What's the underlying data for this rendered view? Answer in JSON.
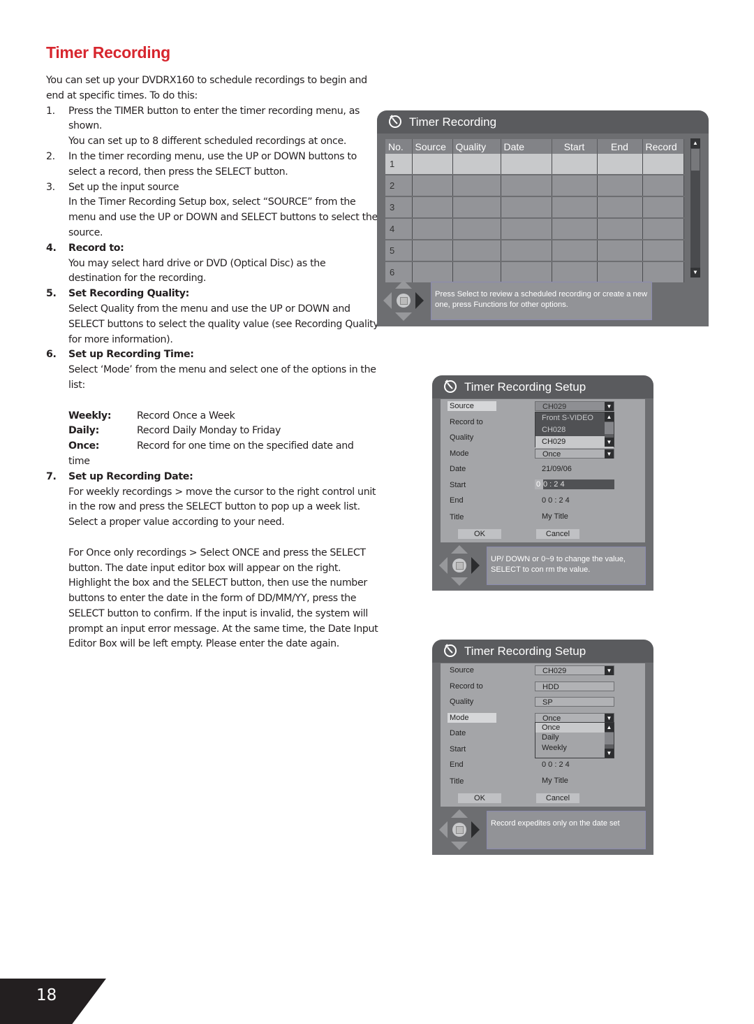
{
  "document": {
    "title": "Timer Recording",
    "intro": "You can set up your DVDRX160 to schedule recordings to begin and end at specific times. To do this:",
    "steps": [
      {
        "num": "1.",
        "heading": "",
        "text": "Press the TIMER button to enter the timer recording menu, as shown.",
        "extra": "You can set up to 8 different scheduled recordings at once."
      },
      {
        "num": "2.",
        "heading": "",
        "text": "In the timer recording menu, use the UP or DOWN buttons to select a record, then press the SELECT button.",
        "extra": ""
      },
      {
        "num": "3.",
        "heading": "",
        "text": "Set up the input source",
        "extra": "In the Timer Recording Setup box, select “SOURCE” from the menu and use the UP or DOWN and SELECT buttons to select the source."
      },
      {
        "num": "4.",
        "heading": "Record to:",
        "text": "You may select hard drive or DVD (Optical Disc) as the destination for the recording.",
        "extra": ""
      },
      {
        "num": "5.",
        "heading": "Set Recording Quality:",
        "text": "Select Quality from the menu and use the UP or DOWN and SELECT buttons to select the quality value (see Recording Quality for more information).",
        "extra": ""
      },
      {
        "num": "6.",
        "heading": "Set up Recording Time:",
        "text": "Select ‘Mode’ from the menu and select one of the options in the list:",
        "extra": ""
      },
      {
        "num": "7.",
        "heading": "Set up Recording Date:",
        "text": "For weekly recordings > move the cursor to the right control unit in the row and press the SELECT button to pop up a week list. Select a proper value according to your need.",
        "extra": "For Once only recordings > Select ONCE and press the SELECT button. The date input editor box will appear on the right. Highlight the box and the SELECT button, then use the number buttons to enter the date in the form of DD/MM/YY, press the SELECT button to confirm. If the input is invalid, the system will prompt an input error message. At the same time, the Date Input Editor Box will be left empty. Please enter the date again."
      }
    ],
    "modes": [
      {
        "key": "Weekly:",
        "desc": "Record Once a Week"
      },
      {
        "key": "Daily:",
        "desc": "Record Daily Monday to Friday"
      },
      {
        "key": "Once:",
        "desc": "Record for one time on the specified date and"
      }
    ],
    "modes_wrap": "time",
    "page_number": "18"
  },
  "timer_window": {
    "title": "Timer Recording",
    "icon": "timer-clock-icon",
    "columns": [
      "No.",
      "Source",
      "Quality",
      "Date",
      "Start",
      "End",
      "Record"
    ],
    "rows": [
      {
        "no": "1",
        "source": "",
        "quality": "",
        "date": "",
        "start": "",
        "end": "",
        "record": ""
      },
      {
        "no": "2",
        "source": "",
        "quality": "",
        "date": "",
        "start": "",
        "end": "",
        "record": ""
      },
      {
        "no": "3",
        "source": "",
        "quality": "",
        "date": "",
        "start": "",
        "end": "",
        "record": ""
      },
      {
        "no": "4",
        "source": "",
        "quality": "",
        "date": "",
        "start": "",
        "end": "",
        "record": ""
      },
      {
        "no": "5",
        "source": "",
        "quality": "",
        "date": "",
        "start": "",
        "end": "",
        "record": ""
      },
      {
        "no": "6",
        "source": "",
        "quality": "",
        "date": "",
        "start": "",
        "end": "",
        "record": ""
      }
    ],
    "selected_row": 0,
    "scroll_up": "▲",
    "scroll_down": "▼",
    "help": "Press Select to review a scheduled recording or create a new one, press Functions for other options."
  },
  "setup_window_1": {
    "title": "Timer Recording Setup",
    "labels": {
      "source": "Source",
      "record_to": "Record to",
      "quality": "Quality",
      "mode": "Mode",
      "date": "Date",
      "start": "Start",
      "end": "End",
      "title": "Title"
    },
    "values": {
      "source": "CH029",
      "mode": "Once",
      "date": "21/09/06",
      "start_cursor": "0",
      "start_rest": "0 : 2 4",
      "end": "0 0 : 2 4",
      "title": "My Title"
    },
    "source_dropdown": {
      "options": [
        "Front S-VIDEO",
        "CH028",
        "CH029"
      ],
      "selected": "CH029"
    },
    "ok": "OK",
    "cancel": "Cancel",
    "arrow_down": "▼",
    "arrow_up": "▲",
    "help": "UP/ DOWN or 0~9 to change the value, SELECT to con  rm the value."
  },
  "setup_window_2": {
    "title": "Timer Recording Setup",
    "labels": {
      "source": "Source",
      "record_to": "Record to",
      "quality": "Quality",
      "mode": "Mode",
      "date": "Date",
      "start": "Start",
      "end": "End",
      "title": "Title"
    },
    "values": {
      "source": "CH029",
      "record_to": "HDD",
      "quality": "SP",
      "mode": "Once",
      "end": "0 0 : 2 4",
      "title": "My Title"
    },
    "mode_dropdown": {
      "options": [
        "Once",
        "Daily",
        "Weekly"
      ],
      "selected": "Once"
    },
    "ok": "OK",
    "cancel": "Cancel",
    "arrow_down": "▼",
    "arrow_up": "▲",
    "help": "Record expedites only on the date set"
  }
}
